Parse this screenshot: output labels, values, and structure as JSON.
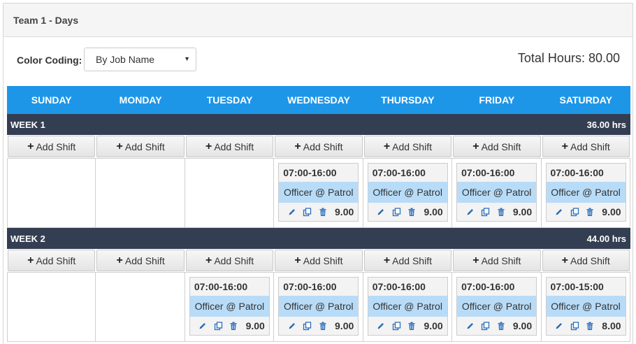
{
  "panel": {
    "title": "Team 1 - Days"
  },
  "controls": {
    "color_coding_label": "Color Coding:",
    "color_coding_value": "By Job Name",
    "total_hours": "Total Hours: 80.00"
  },
  "days": [
    "SUNDAY",
    "MONDAY",
    "TUESDAY",
    "WEDNESDAY",
    "THURSDAY",
    "FRIDAY",
    "SATURDAY"
  ],
  "add_shift_label": "Add Shift",
  "colors": {
    "header_blue": "#1e96e8",
    "week_bar": "#343e52",
    "job_bg": "#b8dcf8",
    "icon_blue": "#2a6ebd"
  },
  "weeks": [
    {
      "label": "WEEK 1",
      "hours": "36.00 hrs",
      "shifts": [
        null,
        null,
        null,
        {
          "time": "07:00-16:00",
          "job": "Officer @ Patrol",
          "hours": "9.00"
        },
        {
          "time": "07:00-16:00",
          "job": "Officer @ Patrol",
          "hours": "9.00"
        },
        {
          "time": "07:00-16:00",
          "job": "Officer @ Patrol",
          "hours": "9.00"
        },
        {
          "time": "07:00-16:00",
          "job": "Officer @ Patrol",
          "hours": "9.00"
        }
      ]
    },
    {
      "label": "WEEK 2",
      "hours": "44.00 hrs",
      "shifts": [
        null,
        null,
        {
          "time": "07:00-16:00",
          "job": "Officer @ Patrol",
          "hours": "9.00"
        },
        {
          "time": "07:00-16:00",
          "job": "Officer @ Patrol",
          "hours": "9.00"
        },
        {
          "time": "07:00-16:00",
          "job": "Officer @ Patrol",
          "hours": "9.00"
        },
        {
          "time": "07:00-16:00",
          "job": "Officer @ Patrol",
          "hours": "9.00"
        },
        {
          "time": "07:00-15:00",
          "job": "Officer @ Patrol",
          "hours": "8.00"
        }
      ]
    }
  ]
}
